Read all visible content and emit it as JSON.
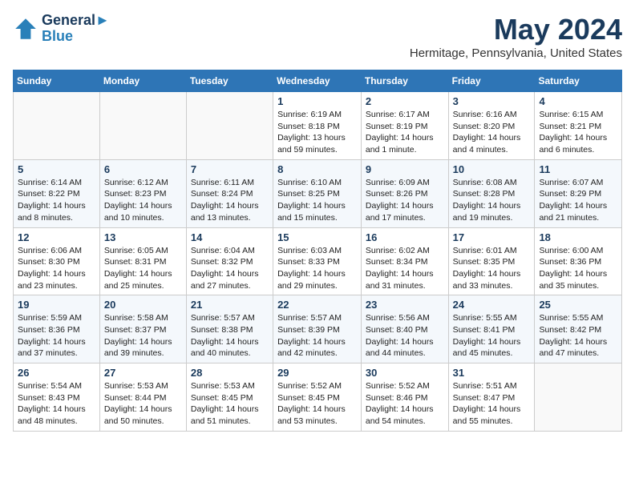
{
  "header": {
    "logo_line1": "General",
    "logo_line2": "Blue",
    "main_title": "May 2024",
    "subtitle": "Hermitage, Pennsylvania, United States"
  },
  "days_of_week": [
    "Sunday",
    "Monday",
    "Tuesday",
    "Wednesday",
    "Thursday",
    "Friday",
    "Saturday"
  ],
  "weeks": [
    [
      {
        "day": "",
        "content": ""
      },
      {
        "day": "",
        "content": ""
      },
      {
        "day": "",
        "content": ""
      },
      {
        "day": "1",
        "content": "Sunrise: 6:19 AM\nSunset: 8:18 PM\nDaylight: 13 hours and 59 minutes."
      },
      {
        "day": "2",
        "content": "Sunrise: 6:17 AM\nSunset: 8:19 PM\nDaylight: 14 hours and 1 minute."
      },
      {
        "day": "3",
        "content": "Sunrise: 6:16 AM\nSunset: 8:20 PM\nDaylight: 14 hours and 4 minutes."
      },
      {
        "day": "4",
        "content": "Sunrise: 6:15 AM\nSunset: 8:21 PM\nDaylight: 14 hours and 6 minutes."
      }
    ],
    [
      {
        "day": "5",
        "content": "Sunrise: 6:14 AM\nSunset: 8:22 PM\nDaylight: 14 hours and 8 minutes."
      },
      {
        "day": "6",
        "content": "Sunrise: 6:12 AM\nSunset: 8:23 PM\nDaylight: 14 hours and 10 minutes."
      },
      {
        "day": "7",
        "content": "Sunrise: 6:11 AM\nSunset: 8:24 PM\nDaylight: 14 hours and 13 minutes."
      },
      {
        "day": "8",
        "content": "Sunrise: 6:10 AM\nSunset: 8:25 PM\nDaylight: 14 hours and 15 minutes."
      },
      {
        "day": "9",
        "content": "Sunrise: 6:09 AM\nSunset: 8:26 PM\nDaylight: 14 hours and 17 minutes."
      },
      {
        "day": "10",
        "content": "Sunrise: 6:08 AM\nSunset: 8:28 PM\nDaylight: 14 hours and 19 minutes."
      },
      {
        "day": "11",
        "content": "Sunrise: 6:07 AM\nSunset: 8:29 PM\nDaylight: 14 hours and 21 minutes."
      }
    ],
    [
      {
        "day": "12",
        "content": "Sunrise: 6:06 AM\nSunset: 8:30 PM\nDaylight: 14 hours and 23 minutes."
      },
      {
        "day": "13",
        "content": "Sunrise: 6:05 AM\nSunset: 8:31 PM\nDaylight: 14 hours and 25 minutes."
      },
      {
        "day": "14",
        "content": "Sunrise: 6:04 AM\nSunset: 8:32 PM\nDaylight: 14 hours and 27 minutes."
      },
      {
        "day": "15",
        "content": "Sunrise: 6:03 AM\nSunset: 8:33 PM\nDaylight: 14 hours and 29 minutes."
      },
      {
        "day": "16",
        "content": "Sunrise: 6:02 AM\nSunset: 8:34 PM\nDaylight: 14 hours and 31 minutes."
      },
      {
        "day": "17",
        "content": "Sunrise: 6:01 AM\nSunset: 8:35 PM\nDaylight: 14 hours and 33 minutes."
      },
      {
        "day": "18",
        "content": "Sunrise: 6:00 AM\nSunset: 8:36 PM\nDaylight: 14 hours and 35 minutes."
      }
    ],
    [
      {
        "day": "19",
        "content": "Sunrise: 5:59 AM\nSunset: 8:36 PM\nDaylight: 14 hours and 37 minutes."
      },
      {
        "day": "20",
        "content": "Sunrise: 5:58 AM\nSunset: 8:37 PM\nDaylight: 14 hours and 39 minutes."
      },
      {
        "day": "21",
        "content": "Sunrise: 5:57 AM\nSunset: 8:38 PM\nDaylight: 14 hours and 40 minutes."
      },
      {
        "day": "22",
        "content": "Sunrise: 5:57 AM\nSunset: 8:39 PM\nDaylight: 14 hours and 42 minutes."
      },
      {
        "day": "23",
        "content": "Sunrise: 5:56 AM\nSunset: 8:40 PM\nDaylight: 14 hours and 44 minutes."
      },
      {
        "day": "24",
        "content": "Sunrise: 5:55 AM\nSunset: 8:41 PM\nDaylight: 14 hours and 45 minutes."
      },
      {
        "day": "25",
        "content": "Sunrise: 5:55 AM\nSunset: 8:42 PM\nDaylight: 14 hours and 47 minutes."
      }
    ],
    [
      {
        "day": "26",
        "content": "Sunrise: 5:54 AM\nSunset: 8:43 PM\nDaylight: 14 hours and 48 minutes."
      },
      {
        "day": "27",
        "content": "Sunrise: 5:53 AM\nSunset: 8:44 PM\nDaylight: 14 hours and 50 minutes."
      },
      {
        "day": "28",
        "content": "Sunrise: 5:53 AM\nSunset: 8:45 PM\nDaylight: 14 hours and 51 minutes."
      },
      {
        "day": "29",
        "content": "Sunrise: 5:52 AM\nSunset: 8:45 PM\nDaylight: 14 hours and 53 minutes."
      },
      {
        "day": "30",
        "content": "Sunrise: 5:52 AM\nSunset: 8:46 PM\nDaylight: 14 hours and 54 minutes."
      },
      {
        "day": "31",
        "content": "Sunrise: 5:51 AM\nSunset: 8:47 PM\nDaylight: 14 hours and 55 minutes."
      },
      {
        "day": "",
        "content": ""
      }
    ]
  ]
}
